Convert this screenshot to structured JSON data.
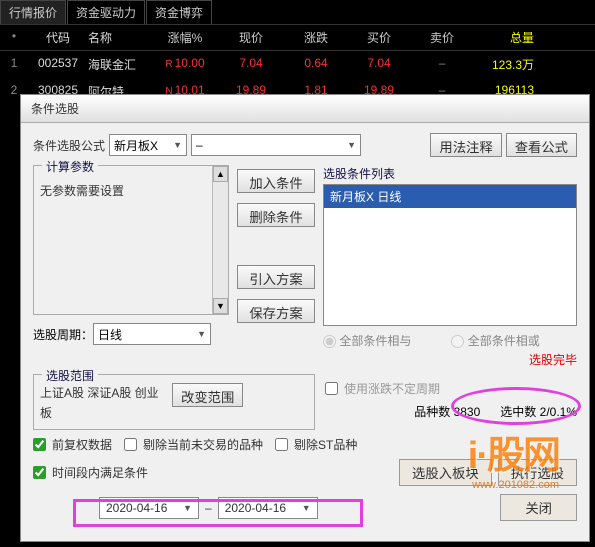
{
  "tabs": {
    "t0": "行情报价",
    "t1": "资金驱动力",
    "t2": "资金博弈"
  },
  "headers": {
    "code": "代码",
    "name": "名称",
    "pct": "涨幅%",
    "price": "现价",
    "chg": "涨跌",
    "bid": "买价",
    "ask": "卖价",
    "vol": "总量"
  },
  "rows": [
    {
      "idx": "1",
      "code": "002537",
      "name": "海联金汇",
      "flag": "R",
      "pct": "10.00",
      "price": "7.04",
      "chg": "0.64",
      "bid": "7.04",
      "ask": "–",
      "vol": "123.3万"
    },
    {
      "idx": "2",
      "code": "300825",
      "name": "阿尔特",
      "flag": "N",
      "pct": "10.01",
      "price": "19.89",
      "chg": "1.81",
      "bid": "19.89",
      "ask": "–",
      "vol": "196113"
    }
  ],
  "dialog": {
    "title": "条件选股",
    "formula_label": "条件选股公式",
    "formula_sel": "新月板X",
    "formula_dash": "–",
    "btn_usage": "用法注释",
    "btn_view": "查看公式",
    "params_legend": "计算参数",
    "params_text": "无参数需要设置",
    "btn_add": "加入条件",
    "btn_del": "删除条件",
    "btn_import": "引入方案",
    "btn_save": "保存方案",
    "cond_legend": "选股条件列表",
    "cond_item": "新月板X  日线",
    "radio_and": "全部条件相与",
    "radio_or": "全部条件相或",
    "status": "选股完毕",
    "period_label": "选股周期：",
    "period_sel": "日线",
    "range_legend": "选股范围",
    "range_text": "上证A股 深证A股 创业板",
    "btn_range": "改变范围",
    "chk_undef": "使用涨跌不定周期",
    "count_kinds_label": "品种数",
    "count_kinds": "3830",
    "count_sel_label": "选中数",
    "count_sel": "2/0.1%",
    "chk_fq": "前复权数据",
    "chk_exc_nontrade": "剔除当前未交易的品种",
    "chk_exc_st": "剔除ST品种",
    "chk_timerange": "时间段内满足条件",
    "btn_toblock": "选股入板块",
    "btn_exec": "执行选股",
    "date_from": "2020-04-16",
    "date_sep": "–",
    "date_to": "2020-04-16",
    "btn_close": "关闭"
  },
  "watermark": {
    "main": "i·股网",
    "url": "www.201082.com"
  }
}
